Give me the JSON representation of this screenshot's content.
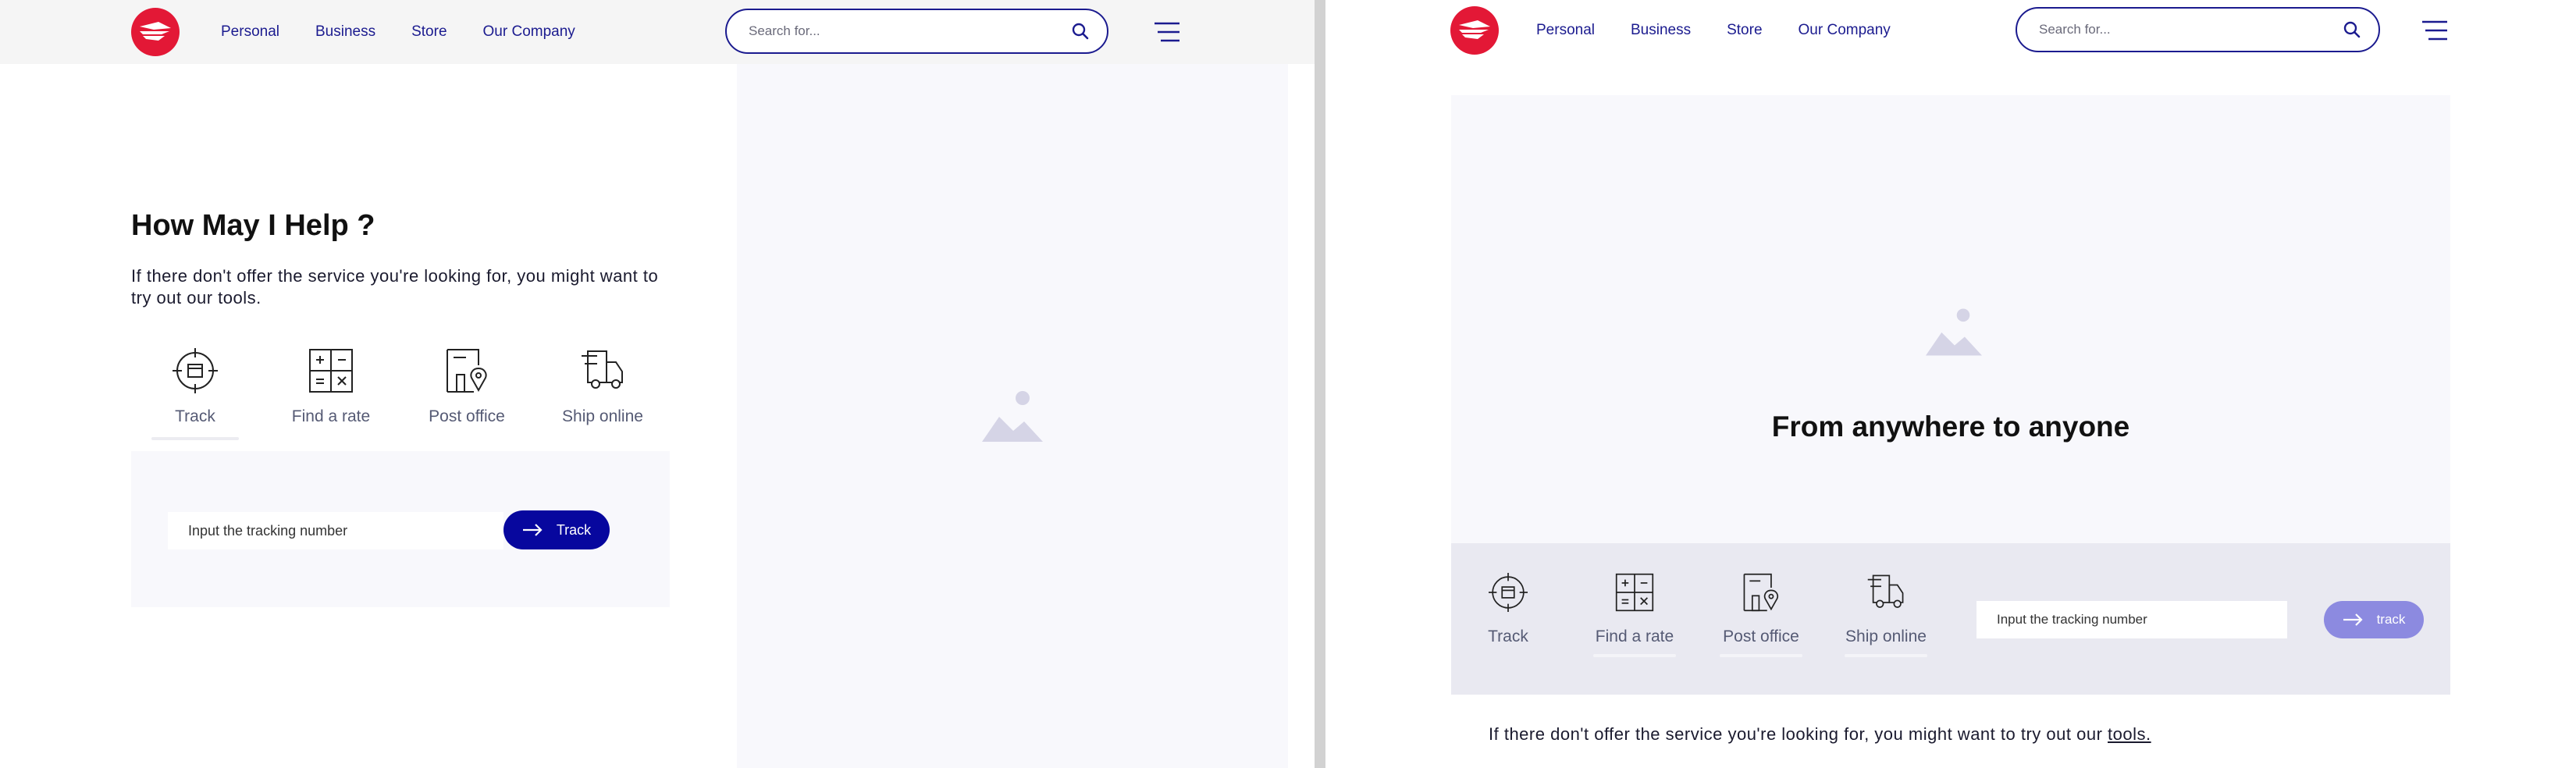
{
  "brand": {
    "accent": "#1b1b8f",
    "logo_red": "#e31836",
    "button_dark": "#07079e",
    "button_light": "#8c8ae0"
  },
  "nav": {
    "items": [
      "Personal",
      "Business",
      "Store",
      "Our Company"
    ]
  },
  "search": {
    "placeholder": "Search for..."
  },
  "left": {
    "heading": "How May I Help ?",
    "lead": "If there don't offer the service you're looking for, you might want to try out our tools.",
    "tools": [
      {
        "label": "Track",
        "icon": "track-target-icon",
        "active": true
      },
      {
        "label": "Find a rate",
        "icon": "calculator-icon",
        "active": false
      },
      {
        "label": "Post office",
        "icon": "post-office-location-icon",
        "active": false
      },
      {
        "label": "Ship online",
        "icon": "delivery-truck-icon",
        "active": false
      }
    ],
    "tracking": {
      "placeholder": "Input the tracking number",
      "button": "Track"
    }
  },
  "right": {
    "hero_title": "From anywhere to anyone",
    "tools": [
      {
        "label": "Track",
        "icon": "track-target-icon"
      },
      {
        "label": "Find a rate",
        "icon": "calculator-icon"
      },
      {
        "label": "Post office",
        "icon": "post-office-location-icon"
      },
      {
        "label": "Ship online",
        "icon": "delivery-truck-icon"
      }
    ],
    "tracking": {
      "placeholder": "Input the tracking number",
      "button": "track"
    },
    "footer_text": "If there don't offer the service you're looking for, you might want to try out our ",
    "footer_link": "tools."
  }
}
